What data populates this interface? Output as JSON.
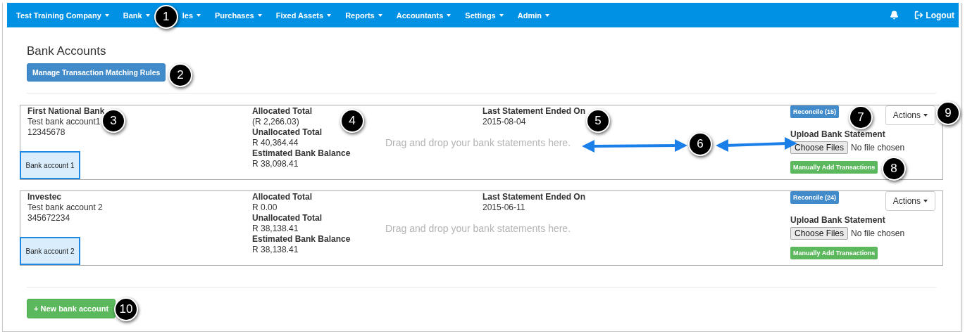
{
  "navbar": {
    "menus": [
      {
        "label": "Test Training Company"
      },
      {
        "label": "Bank"
      },
      {
        "label": "les"
      },
      {
        "label": "Purchases"
      },
      {
        "label": "Fixed Assets"
      },
      {
        "label": "Reports"
      },
      {
        "label": "Accountants"
      },
      {
        "label": "Settings"
      },
      {
        "label": "Admin"
      }
    ],
    "logout": "Logout"
  },
  "page_title": "Bank Accounts",
  "rules_button": "Manage Transaction Matching Rules",
  "accounts": [
    {
      "bank": "First National Bank",
      "name": "Test bank account1",
      "number": "12345678",
      "tag": "Bank account 1",
      "allocated_label": "Allocated Total",
      "allocated": "(R 2,266.03)",
      "unallocated_label": "Unallocated Total",
      "unallocated": "R 40,364.44",
      "balance_label": "Estimated Bank Balance",
      "balance": "R 38,098.41",
      "statement_label": "Last Statement Ended On",
      "statement_date": "2015-08-04",
      "drop_hint": "Drag and drop your bank statements here.",
      "reconcile": "Reconcile (15)",
      "upload_label": "Upload Bank Statement",
      "choose_button": "Choose Files",
      "file_status": "No file chosen",
      "manual_button": "Manually Add Transactions",
      "actions": "Actions"
    },
    {
      "bank": "Investec",
      "name": "Test bank account 2",
      "number": "345672234",
      "tag": "Bank account 2",
      "allocated_label": "Allocated Total",
      "allocated": "R 0.00",
      "unallocated_label": "Unallocated Total",
      "unallocated": "R 38,138.41",
      "balance_label": "Estimated Bank Balance",
      "balance": "R 38,138.41",
      "statement_label": "Last Statement Ended On",
      "statement_date": "2015-06-11",
      "drop_hint": "Drag and drop your bank statements here.",
      "reconcile": "Reconcile (24)",
      "upload_label": "Upload Bank Statement",
      "choose_button": "Choose Files",
      "file_status": "No file chosen",
      "manual_button": "Manually Add Transactions",
      "actions": "Actions"
    }
  ],
  "new_account_button": "+ New bank account",
  "callouts": [
    {
      "number": "1"
    },
    {
      "number": "2"
    },
    {
      "number": "3"
    },
    {
      "number": "4"
    },
    {
      "number": "5"
    },
    {
      "number": "6"
    },
    {
      "number": "7"
    },
    {
      "number": "8"
    },
    {
      "number": "9"
    },
    {
      "number": "10"
    }
  ]
}
